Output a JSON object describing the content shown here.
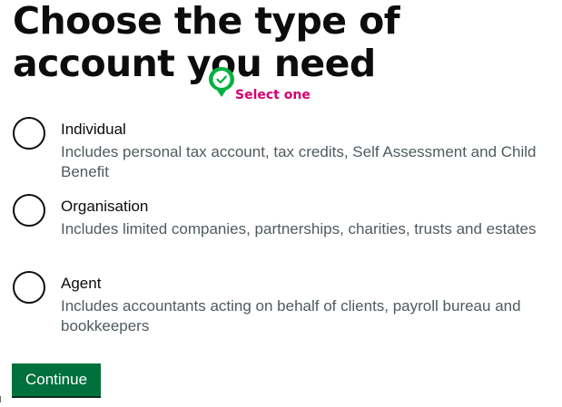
{
  "page": {
    "heading": "Choose the type of account you need",
    "hint_annotation": {
      "text": "Select one",
      "icon": "check-pin-icon",
      "color": "#d6006e",
      "pin_color": "#00b140"
    }
  },
  "options": [
    {
      "label": "Individual",
      "hint": "Includes personal tax account, tax credits, Self Assessment and Child Benefit",
      "selected": false
    },
    {
      "label": "Organisation",
      "hint": "Includes limited companies, partnerships, charities, trusts and estates",
      "selected": false
    },
    {
      "label": "Agent",
      "hint": "Includes accountants acting on behalf of clients, payroll bureau and bookkeepers",
      "selected": false
    }
  ],
  "actions": {
    "continue_label": "Continue",
    "continue_color": "#00703c"
  }
}
